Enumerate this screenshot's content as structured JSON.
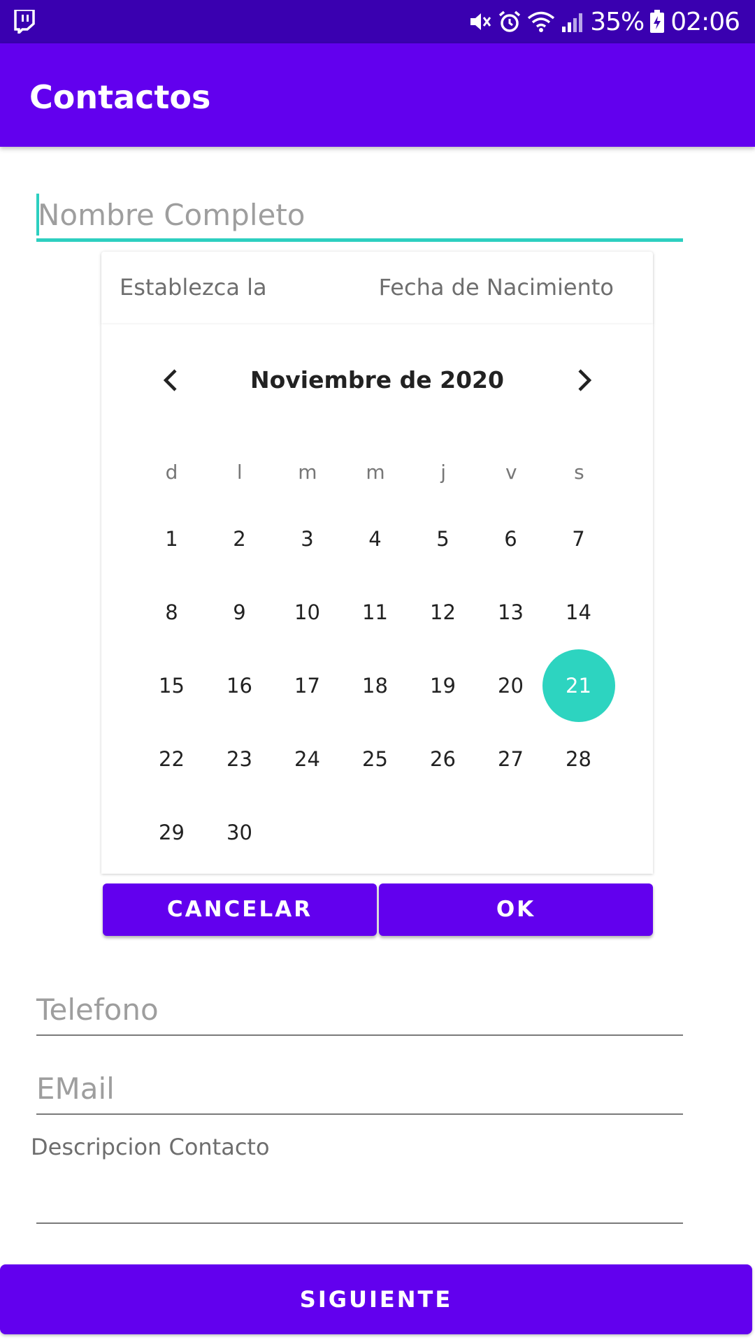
{
  "status_bar": {
    "battery": "35%",
    "time": "02:06",
    "left_icon": "twitch-icon",
    "icons": [
      "mute-icon",
      "alarm-icon",
      "wifi-icon",
      "signal-icon",
      "battery-charging-icon"
    ]
  },
  "app_bar": {
    "title": "Contactos"
  },
  "form": {
    "nombre_placeholder": "Nombre Completo",
    "telefono_placeholder": "Telefono",
    "email_placeholder": "EMail",
    "descripcion_label": "Descripcion Contacto",
    "siguiente_label": "SIGUIENTE"
  },
  "date_dialog": {
    "header_left": "Establezca la",
    "header_right": "Fecha de Nacimiento",
    "month_title": "Noviembre de 2020",
    "weekdays": [
      "d",
      "l",
      "m",
      "m",
      "j",
      "v",
      "s"
    ],
    "first_weekday_index": 0,
    "days_in_month": 30,
    "selected_day": 21,
    "cancel_label": "CANCELAR",
    "ok_label": "OK"
  },
  "colors": {
    "primary": "#6200ee",
    "status_bar": "#3a00b0",
    "accent": "#2dd4c0"
  }
}
